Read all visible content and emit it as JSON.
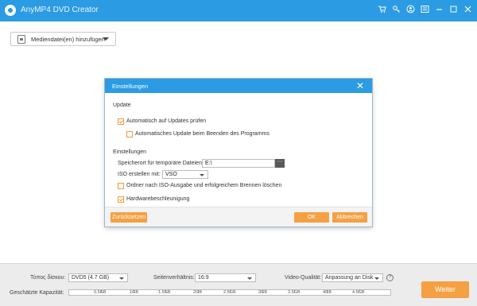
{
  "app": {
    "title": "AnyMP4 DVD Creator"
  },
  "toolbar": {
    "icons": [
      "cart-icon",
      "key-icon",
      "user-icon",
      "menu-icon"
    ],
    "window_controls": [
      "minimize-icon",
      "maximize-icon",
      "close-icon"
    ]
  },
  "add_button": {
    "label": "Mediendatei(en) hinzufügen"
  },
  "dialog": {
    "title": "Einstellungen",
    "update_section": "Update",
    "auto_check": {
      "label": "Automatisch auf Updates prüfen",
      "checked": true
    },
    "auto_update": {
      "label": "Automatisches Update beim Beenden des Programms",
      "checked": false
    },
    "settings_section": "Einstellungen",
    "temp_label": "Speicherort für temporäre Dateien:",
    "temp_value": "E:\\",
    "browse_label": "···",
    "iso_label": "ISO erstellen mit:",
    "iso_value": "VSO",
    "delete_folder": {
      "label": "Ordner nach ISO-Ausgabe und erfolgreichem Brennen löschen",
      "checked": false
    },
    "hw_accel": {
      "label": "Hardwarebeschleunigung",
      "checked": true
    },
    "reset_label": "Zurücksetzen",
    "ok_label": "OK",
    "cancel_label": "Abbrechen"
  },
  "bottom": {
    "disc_type_label": "Τύπος δίσκου:",
    "disc_type_value": "DVD5 (4.7 GB)",
    "aspect_label": "Seitenverhältnis:",
    "aspect_value": "16:9",
    "quality_label": "Video-Qualität:",
    "quality_value": "Anpassung an Disk",
    "help_label": "?",
    "capacity_label": "Geschätzte Kapazität:",
    "capacity_ticks": [
      "0.5GB",
      "1GB",
      "1.5GB",
      "2GB",
      "2.5GB",
      "3GB",
      "3.5GB",
      "4GB",
      "4.5GB"
    ],
    "next_label": "Weiter"
  },
  "colors": {
    "accent": "#2b9be3",
    "button": "#f5a043"
  }
}
